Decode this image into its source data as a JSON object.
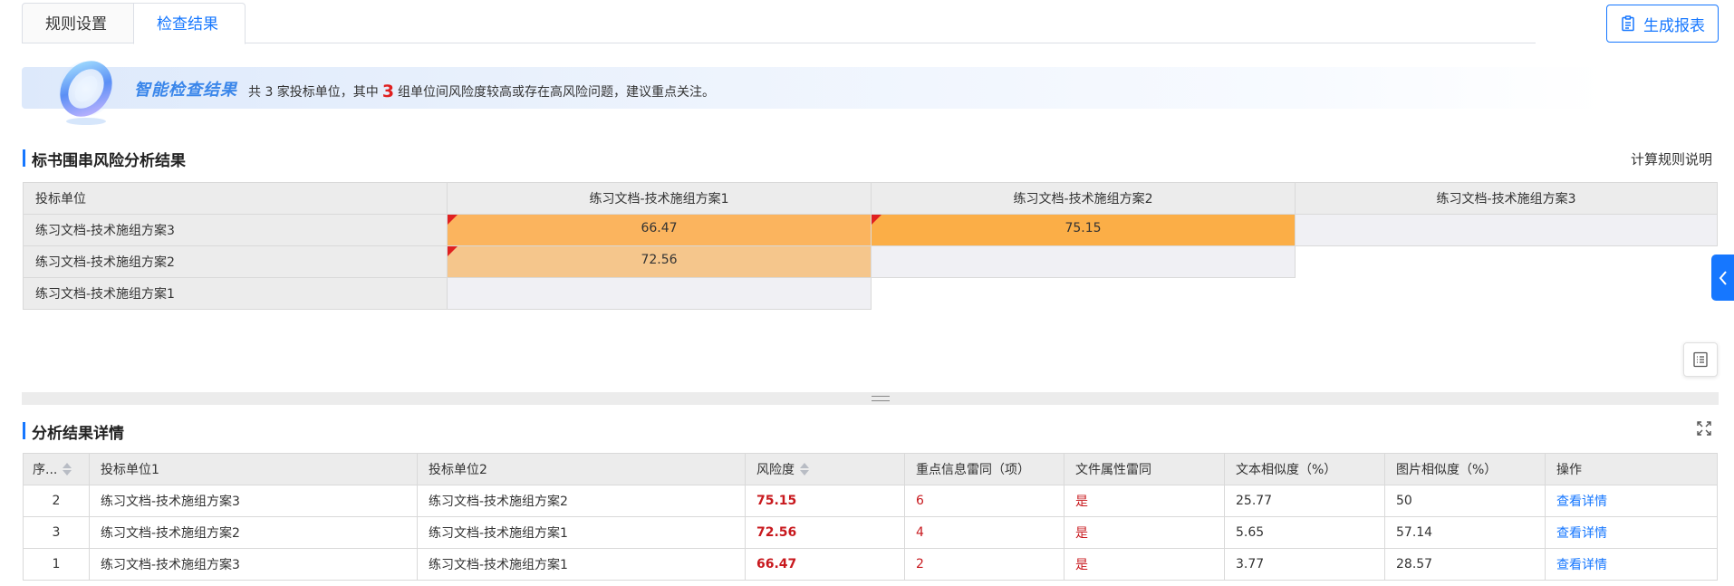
{
  "tabs": [
    {
      "label": "规则设置",
      "active": false
    },
    {
      "label": "检查结果",
      "active": true
    }
  ],
  "toolbar": {
    "report_label": "生成报表"
  },
  "banner": {
    "title": "智能检查结果",
    "text_a": "共 3 家投标单位，其中",
    "highlight": "3",
    "text_b": "组单位间风险度较高或存在高风险问题，建议重点关注。"
  },
  "risk": {
    "title": "标书围串风险分析结果",
    "rule_link": "计算规则说明",
    "corner_header": "投标单位",
    "columns": [
      "练习文档-技术施组方案1",
      "练习文档-技术施组方案2",
      "练习文档-技术施组方案3"
    ],
    "rows": [
      {
        "label": "练习文档-技术施组方案3",
        "v1": "66.47",
        "v2": "75.15"
      },
      {
        "label": "练习文档-技术施组方案2",
        "v1": "72.56"
      },
      {
        "label": "练习文档-技术施组方案1"
      }
    ],
    "colors": {
      "v66": "#fbb45e",
      "v75": "#fbae47",
      "v72": "#f5c68c"
    }
  },
  "details": {
    "title": "分析结果详情",
    "headers": {
      "seq": "序...",
      "unit1": "投标单位1",
      "unit2": "投标单位2",
      "risk": "风险度",
      "key_info": "重点信息雷同（项）",
      "file_attr": "文件属性雷同",
      "text_sim": "文本相似度（%）",
      "img_sim": "图片相似度（%）",
      "action": "操作"
    },
    "rows": [
      {
        "seq": "2",
        "unit1": "练习文档-技术施组方案3",
        "unit2": "练习文档-技术施组方案2",
        "risk": "75.15",
        "key_info": "6",
        "file_attr": "是",
        "text_sim": "25.77",
        "img_sim": "50",
        "action": "查看详情"
      },
      {
        "seq": "3",
        "unit1": "练习文档-技术施组方案2",
        "unit2": "练习文档-技术施组方案1",
        "risk": "72.56",
        "key_info": "4",
        "file_attr": "是",
        "text_sim": "5.65",
        "img_sim": "57.14",
        "action": "查看详情"
      },
      {
        "seq": "1",
        "unit1": "练习文档-技术施组方案3",
        "unit2": "练习文档-技术施组方案1",
        "risk": "66.47",
        "key_info": "2",
        "file_attr": "是",
        "text_sim": "3.77",
        "img_sim": "28.57",
        "action": "查看详情"
      }
    ]
  }
}
